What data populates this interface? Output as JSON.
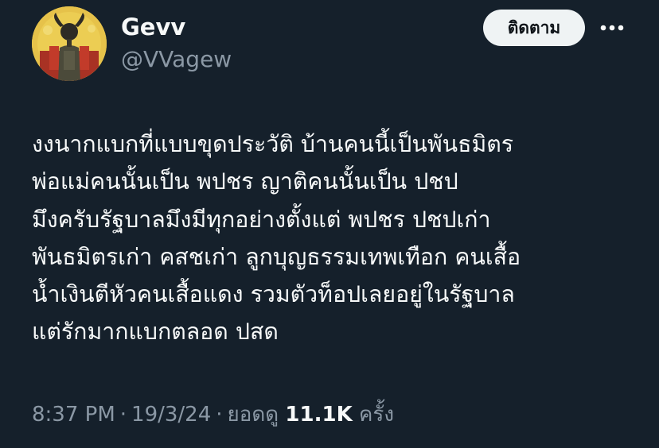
{
  "author": {
    "display_name": "Gevv",
    "handle": "@VVagew"
  },
  "actions": {
    "follow_label": "ติดตาม",
    "more_icon": "more-horizontal-icon"
  },
  "tweet": {
    "lines": [
      "งงนากแบกที่แบบขุดประวัติ บ้านคนนี้เป็นพันธมิตร",
      "พ่อแม่คนนั้นเป็น พปชร ญาติคนนั้นเป็น ปชป",
      "มึงครับรัฐบาลมึงมีทุกอย่างตั้งแต่ พปชร ปชปเก่า",
      "พันธมิตรเก่า คสชเก่า ลูกบุญธรรมเทพเทือก คนเสื้อ",
      "น้ำเงินตีหัวคนเสื้อแดง รวมตัวท็อปเลยอยู่ในรัฐบาล",
      "แต่รักมากแบกตลอด ปสด"
    ]
  },
  "meta": {
    "time": "8:37 PM",
    "separator": "·",
    "date": "19/3/24",
    "views_label": "ยอดดู",
    "views_count": "11.1K",
    "views_unit": "ครั้ง"
  },
  "colors": {
    "background": "#15202b",
    "text_primary": "#f7f9f9",
    "text_secondary": "#8b98a5",
    "button_bg": "#eff3f4",
    "button_text": "#0f1419"
  }
}
